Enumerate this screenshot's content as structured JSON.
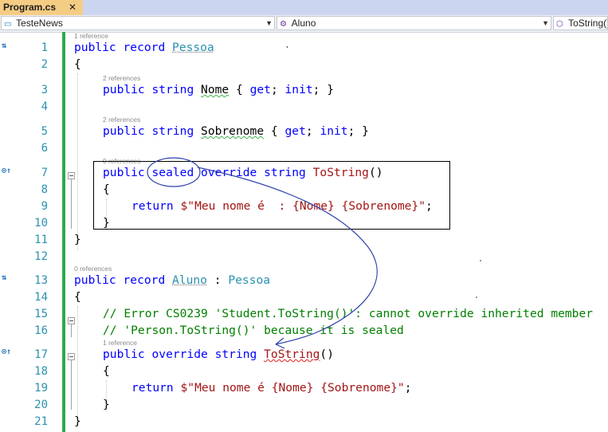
{
  "tab": {
    "title": "Program.cs",
    "close": "✕"
  },
  "nav": {
    "project": "TesteNews",
    "type": "Aluno",
    "member": "ToString()"
  },
  "icons": {
    "project": "csharp-project-icon",
    "type": "record-type-icon",
    "member": "method-icon"
  },
  "colors": {
    "keyword": "#0000ff",
    "type": "#2b91af",
    "string": "#a31515",
    "comment": "#008000",
    "line_number": "#2b91af",
    "change_bar": "#2fa84f",
    "tab_active": "#f5cc84"
  },
  "lens": {
    "l1": "1 reference",
    "l3": "2 references",
    "l5": "2 references",
    "l7": "0 references",
    "l13": "0 references",
    "l17": "1 reference"
  },
  "line_numbers": [
    "1",
    "2",
    "3",
    "4",
    "5",
    "6",
    "7",
    "8",
    "9",
    "10",
    "11",
    "12",
    "13",
    "14",
    "15",
    "16",
    "17",
    "18",
    "19",
    "20",
    "21"
  ],
  "code": {
    "l1": {
      "kw1": "public",
      "kw2": "record",
      "name": "Pessoa"
    },
    "l2": "{",
    "l3": {
      "kw1": "public",
      "kw2": "string",
      "name": "Nome",
      "open": "{",
      "get": "get",
      "init": "init",
      "close": "}"
    },
    "l5": {
      "kw1": "public",
      "kw2": "string",
      "name": "Sobrenome",
      "open": "{",
      "get": "get",
      "init": "init",
      "close": "}"
    },
    "l7": {
      "kw1": "public",
      "kw2": "sealed",
      "kw3": "override",
      "kw4": "string",
      "method": "ToString",
      "parens": "()"
    },
    "l8": "{",
    "l9": {
      "kw": "return",
      "string": "$\"Meu nome é  : {Nome} {Sobrenome}\"",
      "semi": ";"
    },
    "l10": "}",
    "l11": "}",
    "l13": {
      "kw1": "public",
      "kw2": "record",
      "name": "Aluno",
      "colon": ":",
      "base": "Pessoa"
    },
    "l14": "{",
    "l15": "// Error CS0239 'Student.ToString()': cannot override inherited member",
    "l16": "// 'Person.ToString()' because it is sealed",
    "l17": {
      "kw1": "public",
      "kw2": "override",
      "kw3": "string",
      "method": "ToString",
      "parens": "()"
    },
    "l18": "{",
    "l19": {
      "kw": "return",
      "string": "$\"Meu nome é {Nome} {Sobrenome}\"",
      "semi": ";"
    },
    "l20": "}",
    "l21": "}"
  }
}
